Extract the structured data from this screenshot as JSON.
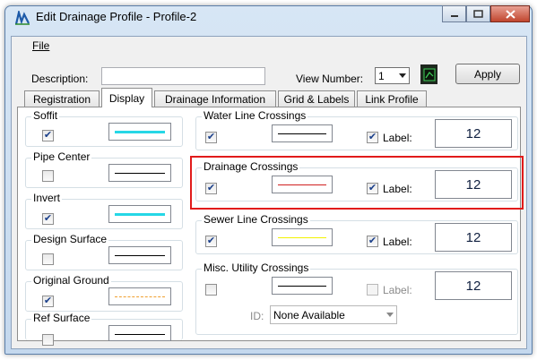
{
  "window": {
    "title": "Edit Drainage Profile - Profile-2"
  },
  "menu": {
    "file": "File"
  },
  "toolbar": {
    "description_label": "Description:",
    "description_value": "",
    "view_number_label": "View Number:",
    "view_number_value": "1",
    "apply_label": "Apply"
  },
  "tabs": [
    "Registration",
    "Display",
    "Drainage Information",
    "Grid & Labels",
    "Link Profile"
  ],
  "left_groups": [
    {
      "title": "Soffit",
      "checked": true,
      "line_color": "#26d7e6",
      "line_style": "solid-thick"
    },
    {
      "title": "Pipe Center",
      "checked": false,
      "line_color": "#000000",
      "line_style": "solid"
    },
    {
      "title": "Invert",
      "checked": true,
      "line_color": "#26d7e6",
      "line_style": "solid-thick"
    },
    {
      "title": "Design Surface",
      "checked": false,
      "line_color": "#000000",
      "line_style": "solid"
    },
    {
      "title": "Original Ground",
      "checked": true,
      "line_color": "#f0a030",
      "line_style": "dashed"
    },
    {
      "title": "Ref Surface",
      "checked": false,
      "line_color": "#000000",
      "line_style": "solid"
    }
  ],
  "right_groups": [
    {
      "title": "Water Line Crossings",
      "checked": true,
      "line_color": "#000000",
      "label_checked": true,
      "label_text": "Label:",
      "text_symbol": "12"
    },
    {
      "title": "Drainage Crossings",
      "checked": true,
      "line_color": "#d02020",
      "label_checked": true,
      "label_text": "Label:",
      "text_symbol": "12",
      "highlighted": true
    },
    {
      "title": "Sewer Line Crossings",
      "checked": true,
      "line_color": "#f2f200",
      "label_checked": true,
      "label_text": "Label:",
      "text_symbol": "12"
    },
    {
      "title": "Misc. Utility Crossings",
      "checked": false,
      "line_color": "#000000",
      "label_checked": false,
      "label_text": "Label:",
      "text_symbol": "12",
      "id_label": "ID:",
      "id_value": "None Available"
    }
  ],
  "colors": {
    "highlight": "#e11b1b",
    "accent": "#26d7e6"
  },
  "icons": {
    "app": "profile-app-icon",
    "view": "view-window-icon",
    "check": "checkmark-icon"
  }
}
